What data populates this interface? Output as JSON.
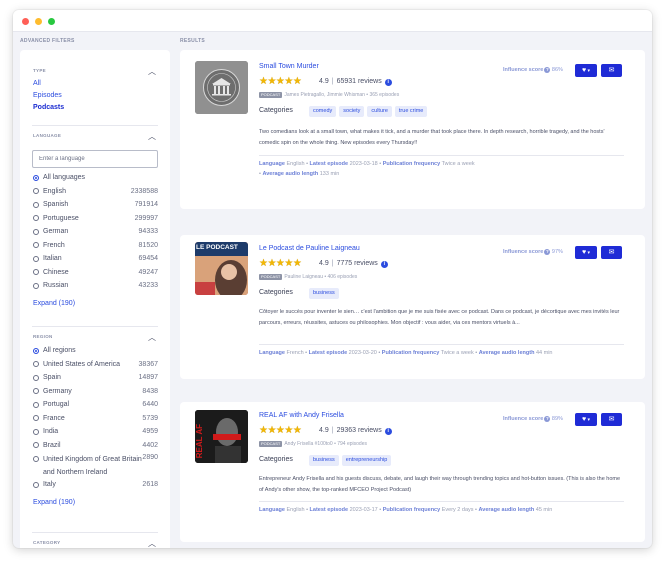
{
  "headers": {
    "filters": "ADVANCED FILTERS",
    "results": "RESULTS"
  },
  "filters": {
    "type": {
      "title": "TYPE",
      "items": [
        {
          "label": "All",
          "active": false
        },
        {
          "label": "Episodes",
          "active": false
        },
        {
          "label": "Podcasts",
          "active": true
        }
      ]
    },
    "language": {
      "title": "LANGUAGE",
      "placeholder": "Enter a language",
      "options": [
        {
          "label": "All languages",
          "count": "",
          "checked": true
        },
        {
          "label": "English",
          "count": "2338588"
        },
        {
          "label": "Spanish",
          "count": "791914"
        },
        {
          "label": "Portuguese",
          "count": "299997"
        },
        {
          "label": "German",
          "count": "94333"
        },
        {
          "label": "French",
          "count": "81520"
        },
        {
          "label": "Italian",
          "count": "69454"
        },
        {
          "label": "Chinese",
          "count": "49247"
        },
        {
          "label": "Russian",
          "count": "43233"
        }
      ],
      "expand": "Expand (190)"
    },
    "region": {
      "title": "REGION",
      "options": [
        {
          "label": "All regions",
          "count": "",
          "checked": true
        },
        {
          "label": "United States of America",
          "count": "38367"
        },
        {
          "label": "Spain",
          "count": "14897"
        },
        {
          "label": "Germany",
          "count": "8438"
        },
        {
          "label": "Portugal",
          "count": "6440"
        },
        {
          "label": "France",
          "count": "5739"
        },
        {
          "label": "India",
          "count": "4959"
        },
        {
          "label": "Brazil",
          "count": "4402"
        },
        {
          "label": "United Kingdom of Great Britain and Northern Ireland",
          "count": "2890"
        },
        {
          "label": "Italy",
          "count": "2618"
        }
      ],
      "expand": "Expand (190)"
    },
    "category": {
      "title": "CATEGORY"
    }
  },
  "results": [
    {
      "title": "Small Town Murder",
      "stars": "★★★★★",
      "rating": "4.9",
      "reviews": "65931 reviews",
      "podcast_tag": "PODCAST",
      "meta": "James Pietragallo, Jimmie Whisman • 365 episodes",
      "categories_label": "Categories",
      "categories": [
        "comedy",
        "society",
        "culture",
        "true crime"
      ],
      "description": "Two comedians look at a small town, what makes it tick, and a murder that took place there. In depth research, horrible tragedy, and the hosts' comedic spin on the whole thing. New episodes every Thursday!!",
      "stats": [
        {
          "label": "Language",
          "value": "English"
        },
        {
          "label": "Latest episode",
          "value": "2023-03-18"
        },
        {
          "label": "Publication frequency",
          "value": "Twice a week"
        },
        {
          "label": "Average audio length",
          "value": "133 min"
        }
      ],
      "score_label": "Influence score",
      "score": "86%"
    },
    {
      "title": "Le Podcast de Pauline Laigneau",
      "stars": "★★★★★",
      "rating": "4.9",
      "reviews": "7775 reviews",
      "podcast_tag": "PODCAST",
      "meta": "Pauline Laigneau • 406 episodes",
      "categories_label": "Categories",
      "categories": [
        "business"
      ],
      "description": "Côtoyer le succès pour inventer le sien… c'est l'ambition que je me suis fixée avec ce podcast. Dans ce podcast, je décortique avec mes invités leur parcours, erreurs, réussites, astuces ou philosophies. Mon objectif : vous aider, via ces mentors virtuels à...",
      "stats": [
        {
          "label": "Language",
          "value": "French"
        },
        {
          "label": "Latest episode",
          "value": "2023-03-20"
        },
        {
          "label": "Publication frequency",
          "value": "Twice a week"
        },
        {
          "label": "Average audio length",
          "value": "44 min"
        }
      ],
      "score_label": "Influence score",
      "score": "97%",
      "thumb_text": "LE PODCAST"
    },
    {
      "title": "REAL AF with Andy Frisella",
      "stars": "★★★★★",
      "rating": "4.9",
      "reviews": "29363 reviews",
      "podcast_tag": "PODCAST",
      "meta": "Andy Frisella #100to0 • 794 episodes",
      "categories_label": "Categories",
      "categories": [
        "business",
        "entrepreneurship"
      ],
      "description": "Entrepreneur Andy Frisella and his guests discuss, debate, and laugh their way through trending topics and hot-button issues. (This is also the home of Andy's other show, the top-ranked MFCEO Project Podcast)",
      "stats": [
        {
          "label": "Language",
          "value": "English"
        },
        {
          "label": "Latest episode",
          "value": "2023-03-17"
        },
        {
          "label": "Publication frequency",
          "value": "Every 2 days"
        },
        {
          "label": "Average audio length",
          "value": "45 min"
        }
      ],
      "score_label": "Influence score",
      "score": "89%",
      "thumb_text": "REAL AF"
    }
  ]
}
